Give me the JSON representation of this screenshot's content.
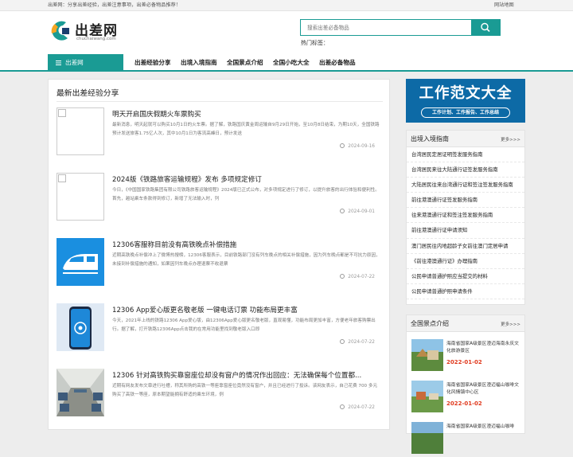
{
  "topbar": {
    "left_text": "出差网：分享出差经验，出差注意事项，出差必备物品推荐！",
    "sitemap": "网站地图"
  },
  "logo": {
    "title": "出差网",
    "url": "chuchaiwang.com"
  },
  "search": {
    "placeholder": "搜索出差必备物品",
    "hot_label": "热门标签："
  },
  "nav": {
    "home": "出差网",
    "items": [
      "出差经验分享",
      "出境入境指南",
      "全国景点介绍",
      "全国小吃大全",
      "出差必备物品"
    ]
  },
  "main": {
    "section_title": "最新出差经验分享",
    "articles": [
      {
        "title": "明天开启国庆假期火车票购买",
        "desc": "最新消息，明天起就可以购买10月1日的火车票。据了解，铁路国庆黄金周运输自9月29日开始，至10月8日结束，为期10天，全国铁路预计发送旅客1.75亿人次，其中10月1日为客流高峰日，预计发送",
        "date": "2024-09-16",
        "thumb": "broken-image-icon"
      },
      {
        "title": "2024版《铁路旅客运输规程》发布 多项规定修订",
        "desc": "今日，《中国国家铁路集团有限公司铁路旅客运输规程》2024版已正式公布，对多项规定进行了修订，以提升旅客的出行体验和便利性。首先，越站乘车条款得到修订，新增了无法输入时，列",
        "date": "2024-09-01",
        "thumb": "broken-image-icon"
      },
      {
        "title": "12306客服称目前没有高铁晚点补偿措施",
        "desc": "近期高铁晚点补偿冲上了微博热搜榜，12306客服表示，目前铁路部门没有列车晚点的相关补偿措施，因为列车晚点都是不可抗力原因，未接到补偿措施的通知，如果因列车晚点办理退票不收退票",
        "date": "2024-07-22",
        "thumb": "train-app-icon"
      },
      {
        "title": "12306 App爱心版更名敬老版 一键电话订票 功能布局更丰富",
        "desc": "今天，2021年上线的铁路12306 App爱心版，由12306App爱心版更名敬老版，直观易懂，功能布局更加丰富，方便老年旅客购票出行。据了解，打开铁路12306App点击我的在常用功能里找到敬老版入口即",
        "date": "2024-07-22",
        "thumb": "phone-app-icon"
      },
      {
        "title": "12306 针对高铁购买靠窗座位却没有窗户的情况作出回应：无法确保每个位置都...",
        "desc": "近期有网友发布文章进行吐槽，称其所购的高铁一等座靠窗座位竟然没有窗户，并且已经进行了投诉。该网友表示，自己花费 700 多元购买了高铁一等座，原本期望能拥有舒适的乘车环境，例",
        "date": "2024-07-22",
        "thumb": "train-interior-photo"
      }
    ]
  },
  "banner": {
    "title": "工作范文大全",
    "subtitle": "工作计划、工作报告、工作总结"
  },
  "guide_box": {
    "title": "出境入境指南",
    "more": "更多>>>",
    "items": [
      "台湾居民定居证明签发服务指南",
      "台湾居民来往大陆通行证签发服务指南",
      "大陆居民往来台湾通行证和签注签发服务指南",
      "前往港澳通行证签发服务指南",
      "往来港澳通行证和签注签发服务指南",
      "前往港澳通行证申请须知",
      "澳门居民往内地超龄子女前往澳门定居申请",
      "《前往港澳通行证》办理指南",
      "公民申请普通护照应当提交的材料",
      "公民申请普通护照申请条件"
    ]
  },
  "spots_box": {
    "title": "全国景点介绍",
    "more": "更多>>>",
    "items": [
      {
        "title": "海南省国家A级景区澄迈海南永庆文化旅游景区",
        "date": "2022-01-02"
      },
      {
        "title": "海南省国家A级景区澄迈福山咖啡文化风情镇中心区",
        "date": "2022-01-02"
      },
      {
        "title": "海南省国家A级景区澄迈福山咖啡",
        "date": ""
      }
    ]
  },
  "colors": {
    "accent": "#1a9b94",
    "date_red": "#e03a1e",
    "banner_blue": "#0d6aa6"
  }
}
